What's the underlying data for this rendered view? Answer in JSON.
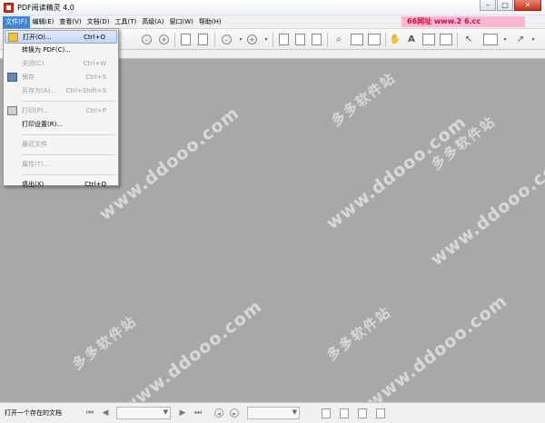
{
  "window": {
    "title": "PDF阅读精灵 4.0",
    "controls": {
      "minimize": "–",
      "maximize": "□",
      "close": "✕"
    }
  },
  "menubar": {
    "items": [
      "文件(F)",
      "编辑(E)",
      "查看(V)",
      "文档(D)",
      "工具(T)",
      "高级(A)",
      "窗口(W)",
      "帮助(H)"
    ],
    "active_index": 0
  },
  "ad_banner": "66网址   www.2  6.cc",
  "file_menu": {
    "items": [
      {
        "label": "打开(O)...",
        "shortcut": "Ctrl+O",
        "enabled": true,
        "highlighted": true,
        "icon": "folder-icon"
      },
      {
        "label": "转换为 PDF(C)...",
        "shortcut": "",
        "enabled": true
      },
      {
        "label": "关闭(C)",
        "shortcut": "Ctrl+W",
        "enabled": false
      },
      {
        "label": "保存",
        "shortcut": "Ctrl+S",
        "enabled": false,
        "icon": "save-icon"
      },
      {
        "label": "另存为(A)...",
        "shortcut": "Ctrl+Shift+S",
        "enabled": false
      },
      {
        "label": "打印(P)...",
        "shortcut": "Ctrl+P",
        "enabled": false,
        "icon": "print-icon"
      },
      {
        "label": "打印设置(R)...",
        "shortcut": "",
        "enabled": true
      },
      {
        "label": "最近文件",
        "shortcut": "",
        "enabled": false
      },
      {
        "label": "属性(T)...",
        "shortcut": "",
        "enabled": false
      },
      {
        "label": "退出(X)",
        "shortcut": "Ctrl+Q",
        "enabled": true
      }
    ]
  },
  "watermarks": {
    "cn": "多多软件站",
    "url": "www.ddooo.com"
  },
  "statusbar": {
    "message": "打开一个存在的文档",
    "nav": {
      "first": "⏮",
      "prev": "◀",
      "next": "▶",
      "last": "⏭"
    }
  }
}
